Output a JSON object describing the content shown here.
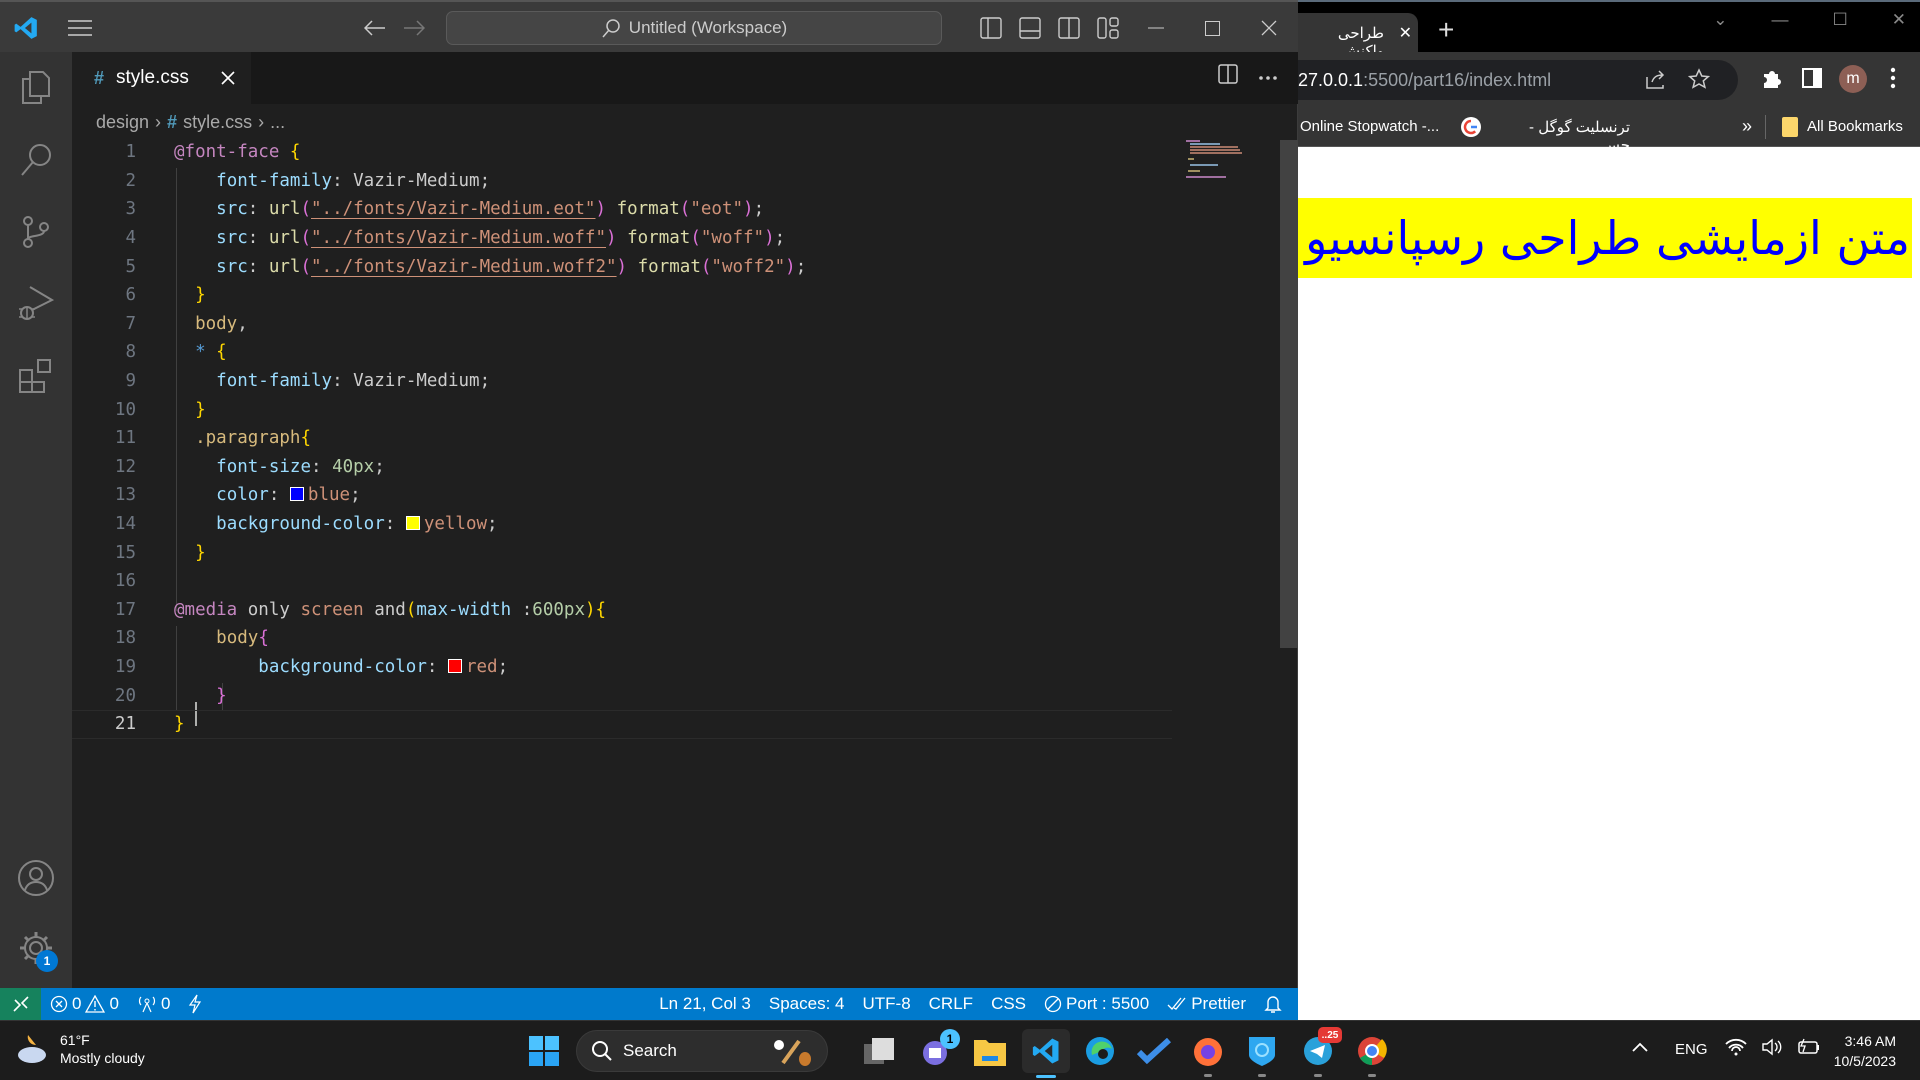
{
  "vscode": {
    "titlebar": {
      "command_center": "Untitled (Workspace)",
      "nav_back": "back",
      "nav_forward": "forward"
    },
    "tab": {
      "icon": "#",
      "label": "style.css"
    },
    "breadcrumb": {
      "folder": "design",
      "file_icon": "#",
      "file": "style.css",
      "more": "..."
    },
    "editor": {
      "current_line": 21,
      "lines": [
        {
          "n": "1",
          "tokens": [
            [
              "at",
              "@font-face"
            ],
            [
              "p",
              " "
            ],
            [
              "br",
              "{"
            ]
          ]
        },
        {
          "n": "2",
          "tokens": [
            [
              "p",
              "    "
            ],
            [
              "prop",
              "font-family"
            ],
            [
              "p",
              ": "
            ],
            [
              "val",
              "Vazir-Medium"
            ],
            [
              "p",
              ";"
            ]
          ]
        },
        {
          "n": "3",
          "tokens": [
            [
              "p",
              "    "
            ],
            [
              "prop",
              "src"
            ],
            [
              "p",
              ": "
            ],
            [
              "fn",
              "url"
            ],
            [
              "br2",
              "("
            ],
            [
              "stru",
              "\"../fonts/Vazir-Medium.eot\""
            ],
            [
              "br2",
              ")"
            ],
            [
              "p",
              " "
            ],
            [
              "fn",
              "format"
            ],
            [
              "br2",
              "("
            ],
            [
              "str",
              "\"eot\""
            ],
            [
              "br2",
              ")"
            ],
            [
              "p",
              ";"
            ]
          ]
        },
        {
          "n": "4",
          "tokens": [
            [
              "p",
              "    "
            ],
            [
              "prop",
              "src"
            ],
            [
              "p",
              ": "
            ],
            [
              "fn",
              "url"
            ],
            [
              "br2",
              "("
            ],
            [
              "stru",
              "\"../fonts/Vazir-Medium.woff\""
            ],
            [
              "br2",
              ")"
            ],
            [
              "p",
              " "
            ],
            [
              "fn",
              "format"
            ],
            [
              "br2",
              "("
            ],
            [
              "str",
              "\"woff\""
            ],
            [
              "br2",
              ")"
            ],
            [
              "p",
              ";"
            ]
          ]
        },
        {
          "n": "5",
          "tokens": [
            [
              "p",
              "    "
            ],
            [
              "prop",
              "src"
            ],
            [
              "p",
              ": "
            ],
            [
              "fn",
              "url"
            ],
            [
              "br2",
              "("
            ],
            [
              "stru",
              "\"../fonts/Vazir-Medium.woff2\""
            ],
            [
              "br2",
              ")"
            ],
            [
              "p",
              " "
            ],
            [
              "fn",
              "format"
            ],
            [
              "br2",
              "("
            ],
            [
              "str",
              "\"woff2\""
            ],
            [
              "br2",
              ")"
            ],
            [
              "p",
              ";"
            ]
          ]
        },
        {
          "n": "6",
          "tokens": [
            [
              "p",
              "  "
            ],
            [
              "br",
              "}"
            ]
          ]
        },
        {
          "n": "7",
          "tokens": [
            [
              "p",
              "  "
            ],
            [
              "sel",
              "body"
            ],
            [
              "p",
              ","
            ]
          ]
        },
        {
          "n": "8",
          "tokens": [
            [
              "p",
              "  "
            ],
            [
              "kw",
              "*"
            ],
            [
              "p",
              " "
            ],
            [
              "br",
              "{"
            ]
          ]
        },
        {
          "n": "9",
          "tokens": [
            [
              "p",
              "    "
            ],
            [
              "prop",
              "font-family"
            ],
            [
              "p",
              ": "
            ],
            [
              "val",
              "Vazir-Medium"
            ],
            [
              "p",
              ";"
            ]
          ]
        },
        {
          "n": "10",
          "tokens": [
            [
              "p",
              "  "
            ],
            [
              "br",
              "}"
            ]
          ]
        },
        {
          "n": "11",
          "tokens": [
            [
              "p",
              "  "
            ],
            [
              "sel",
              ".paragraph"
            ],
            [
              "br",
              "{"
            ]
          ]
        },
        {
          "n": "12",
          "tokens": [
            [
              "p",
              "    "
            ],
            [
              "prop",
              "font-size"
            ],
            [
              "p",
              ": "
            ],
            [
              "num",
              "40px"
            ],
            [
              "p",
              ";"
            ]
          ]
        },
        {
          "n": "13",
          "tokens": [
            [
              "p",
              "    "
            ],
            [
              "prop",
              "color"
            ],
            [
              "p",
              ": "
            ],
            [
              "swatch",
              "#0000ff"
            ],
            [
              "str",
              "blue"
            ],
            [
              "p",
              ";"
            ]
          ]
        },
        {
          "n": "14",
          "tokens": [
            [
              "p",
              "    "
            ],
            [
              "prop",
              "background-color"
            ],
            [
              "p",
              ": "
            ],
            [
              "swatch",
              "#ffff00"
            ],
            [
              "str",
              "yellow"
            ],
            [
              "p",
              ";"
            ]
          ]
        },
        {
          "n": "15",
          "tokens": [
            [
              "p",
              "  "
            ],
            [
              "br",
              "}"
            ]
          ]
        },
        {
          "n": "16",
          "tokens": []
        },
        {
          "n": "17",
          "tokens": [
            [
              "at",
              "@media"
            ],
            [
              "p",
              " "
            ],
            [
              "val",
              "only"
            ],
            [
              "p",
              " "
            ],
            [
              "str",
              "screen"
            ],
            [
              "p",
              " "
            ],
            [
              "val",
              "and"
            ],
            [
              "br",
              "("
            ],
            [
              "prop",
              "max-width"
            ],
            [
              "p",
              " :"
            ],
            [
              "num",
              "600px"
            ],
            [
              "br",
              ")"
            ],
            [
              "br",
              "{"
            ]
          ]
        },
        {
          "n": "18",
          "tokens": [
            [
              "p",
              "    "
            ],
            [
              "sel",
              "body"
            ],
            [
              "br2",
              "{"
            ]
          ]
        },
        {
          "n": "19",
          "tokens": [
            [
              "p",
              "        "
            ],
            [
              "prop",
              "background-color"
            ],
            [
              "p",
              ": "
            ],
            [
              "swatch",
              "#ff0000"
            ],
            [
              "str",
              "red"
            ],
            [
              "p",
              ";"
            ]
          ]
        },
        {
          "n": "20",
          "tokens": [
            [
              "p",
              "    "
            ],
            [
              "br2",
              "}"
            ]
          ]
        },
        {
          "n": "21",
          "tokens": [
            [
              "br",
              "}"
            ]
          ]
        }
      ]
    },
    "status": {
      "errors": "0",
      "warnings": "0",
      "ports": "0",
      "position": "Ln 21, Col 3",
      "spaces": "Spaces: 4",
      "encoding": "UTF-8",
      "eol": "CRLF",
      "language": "CSS",
      "live_server": "Port : 5500",
      "formatter": "Prettier"
    },
    "settings_badge": "1"
  },
  "browser": {
    "tab_title": "طراحی واکنش",
    "url_host": "27.0.0.1",
    "url_path": ":5500/part16/index.html",
    "bookmarks": [
      {
        "label": "Online Stopwatch -...",
        "icon": ""
      },
      {
        "label": "ترنسلیت گوگل - جس...",
        "icon": "google-icon"
      }
    ],
    "bookmarks_more": "»",
    "all_bookmarks": "All Bookmarks",
    "profile_initial": "m",
    "page": {
      "paragraph": "متن ازمایشی طراحی رسپانسیو",
      "paragraph_color": "#0000ff",
      "paragraph_bg": "#ffff00"
    }
  },
  "taskbar": {
    "weather_temp": "61°F",
    "weather_desc": "Mostly cloudy",
    "search_label": "Search",
    "chat_badge": "1",
    "telegram_badge": "..25",
    "language": "ENG",
    "time": "3:46 AM",
    "date": "10/5/2023"
  }
}
